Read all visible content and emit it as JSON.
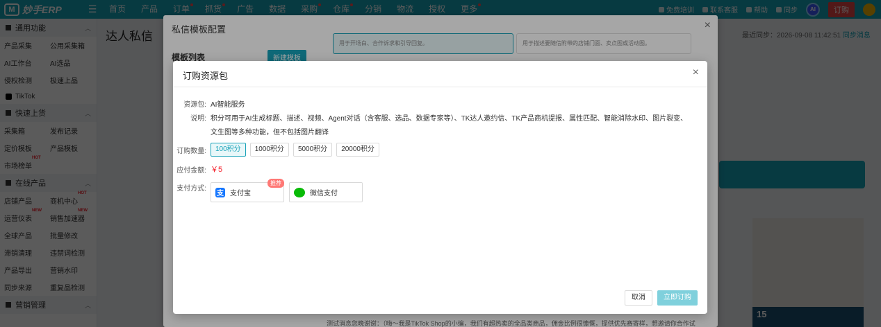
{
  "app": {
    "logo_text": "妙手ERP",
    "logo_mark": "M"
  },
  "nav": [
    "首页",
    "产品",
    "订单",
    "抓货",
    "广告",
    "数据",
    "采购",
    "仓库",
    "分销",
    "物流",
    "授权",
    "更多"
  ],
  "top_right": {
    "training": "免费培训",
    "contact": "联系客服",
    "help": "帮助",
    "sync": "同步",
    "ai_badge": "AI",
    "order_btn": "订购"
  },
  "sidebar": {
    "group1": "通用功能",
    "rows1": [
      [
        "产品采集",
        "公用采集箱"
      ],
      [
        "AI工作台",
        "AI选品"
      ],
      [
        "侵权检测",
        "极速上品"
      ]
    ],
    "tiktok": "TikTok",
    "group2": "快速上货",
    "rows2": [
      [
        "采集箱",
        "发布记录"
      ],
      [
        "定价模板",
        "产品模板"
      ],
      [
        "市场榜单",
        ""
      ]
    ],
    "group3": "在线产品",
    "rows3": [
      [
        "店铺产品",
        "商机中心"
      ],
      [
        "运营仪表",
        "销售加速器"
      ],
      [
        "全球产品",
        "批量修改"
      ],
      [
        "滞销清理",
        "违禁词检测"
      ],
      [
        "产品导出",
        "营销水印"
      ],
      [
        "同步来源",
        "重复品检测"
      ]
    ],
    "group4": "营销管理",
    "flag_hot": "HOT",
    "flag_new": "NEW"
  },
  "main": {
    "title": "达人私信",
    "sync_label": "最近同步：2026-09-08 11:42:51",
    "sync_link": "同步消息"
  },
  "template_dialog": {
    "title": "私信模板配置",
    "list_label": "模板列表",
    "new_btn": "新建模板",
    "hint1": "用于开场白、合作诉求和引导回复。",
    "hint2": "用于描述要随信附带的店铺门面、卖点图或活动图。",
    "footer_text": "测试消息您晚谢谢：（嗨～我是TikTok Shop的小编，我们有超热卖的全品类商品，佣金比例很慷慨，提供优先赛寄样，想邀请你合作试"
  },
  "order_dialog": {
    "title": "订购资源包",
    "fields": {
      "package_label": "资源包:",
      "package_value": "AI智能服务",
      "desc_label": "说明:",
      "desc_value": "积分可用于AI生成标题、描述、视频、Agent对话（含客服、选品、数据专家等）、TK达人邀约信、TK产品商机提报、属性匹配、智能消除水印、图片裂变、文生图等多种功能，但不包括图片翻译",
      "qty_label": "订购数量:",
      "amount_label": "应付金额:",
      "amount_value": "￥5",
      "pay_label": "支付方式:"
    },
    "qty_options": [
      "100积分",
      "1000积分",
      "5000积分",
      "20000积分"
    ],
    "qty_selected": "100积分",
    "pay_options": {
      "alipay": "支付宝",
      "alipay_glyph": "支",
      "wechat": "微信支付",
      "recommend": "推荐"
    },
    "cancel_btn": "取消",
    "submit_btn": "立即订购"
  },
  "colors": {
    "brand": "#17a2b8",
    "danger": "#f5222d",
    "order_btn": "#e84545"
  }
}
